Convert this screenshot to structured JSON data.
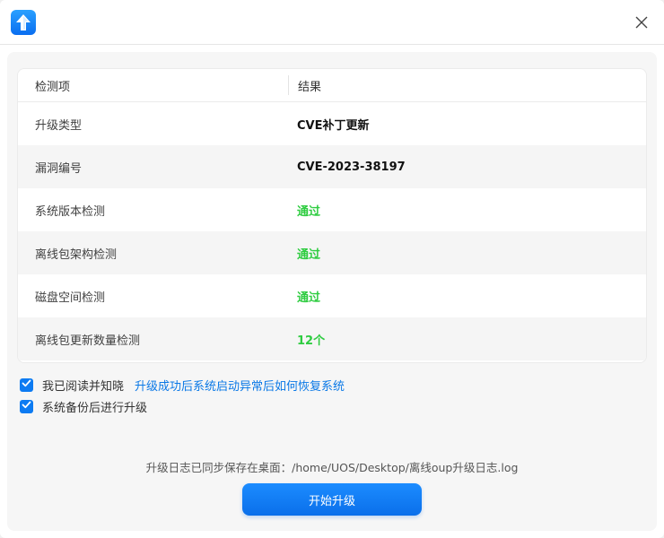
{
  "window": {
    "app_icon": "upload-arrow-icon",
    "close_icon": "close-icon"
  },
  "table": {
    "header": {
      "item": "检测项",
      "result": "结果"
    },
    "rows": [
      {
        "item": "升级类型",
        "result": "CVE补丁更新",
        "status": "normal"
      },
      {
        "item": "漏洞编号",
        "result": "CVE-2023-38197",
        "status": "normal"
      },
      {
        "item": "系统版本检测",
        "result": "通过",
        "status": "pass"
      },
      {
        "item": "离线包架构检测",
        "result": "通过",
        "status": "pass"
      },
      {
        "item": "磁盘空间检测",
        "result": "通过",
        "status": "pass"
      },
      {
        "item": "离线包更新数量检测",
        "result": "12个",
        "status": "pass"
      }
    ]
  },
  "checks": {
    "read_label": "我已阅读并知晓",
    "read_link": "升级成功后系统启动异常后如何恢复系统",
    "read_checked": true,
    "backup_label": "系统备份后进行升级",
    "backup_checked": true
  },
  "log": {
    "label": "升级日志已同步保存在桌面：",
    "path": "/home/UOS/Desktop/离线oup升级日志.log"
  },
  "start_button": {
    "label": "开始升级"
  },
  "colors": {
    "accent": "#0d7bf2",
    "pass": "#2ecc40",
    "link": "#0a78e6"
  }
}
